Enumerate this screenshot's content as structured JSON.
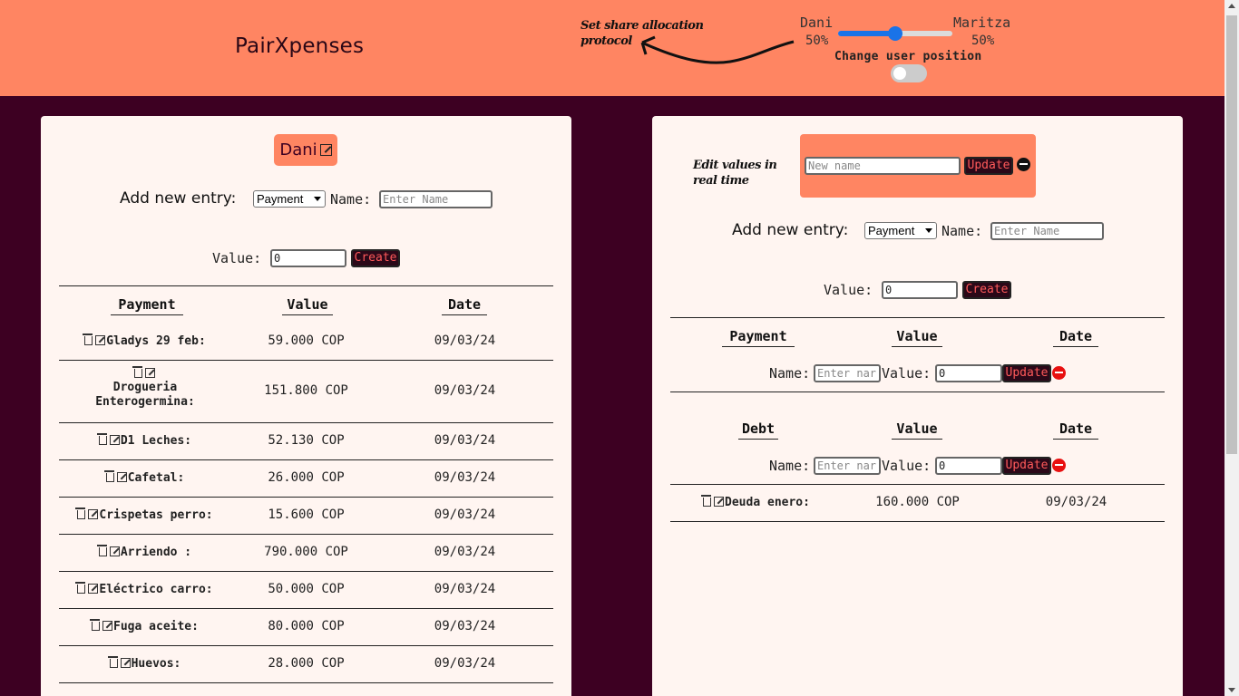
{
  "header": {
    "app_title": "PairXpenses",
    "annotation": "Set share allocation protocol",
    "slider": {
      "user_left": "Dani",
      "user_right": "Maritza",
      "pct_left": "50%",
      "pct_right": "50%",
      "value": 0.5,
      "accent": "#1a73e8"
    },
    "position_label": "Change user position",
    "toggle_on": false
  },
  "colors": {
    "header": "#ff8562",
    "background": "#3d0022",
    "card": "#fff5f1",
    "button_text": "#ff5a5a"
  },
  "left": {
    "user_name": "Dani",
    "add_entry_label": "Add new entry:",
    "entry_type": "Payment",
    "name_label": "Name:",
    "name_placeholder": "Enter Name",
    "value_label": "Value:",
    "value_input": "0",
    "create_label": "Create",
    "columns": [
      "Payment",
      "Value",
      "Date"
    ],
    "rows": [
      {
        "name": "Gladys 29 feb:",
        "value": "59.000 COP",
        "date": "09/03/24"
      },
      {
        "name": "Drogueria Enterogermina:",
        "value": "151.800 COP",
        "date": "09/03/24"
      },
      {
        "name": "D1 Leches:",
        "value": "52.130 COP",
        "date": "09/03/24"
      },
      {
        "name": "Cafetal:",
        "value": "26.000 COP",
        "date": "09/03/24"
      },
      {
        "name": "Crispetas perro:",
        "value": "15.600 COP",
        "date": "09/03/24"
      },
      {
        "name": "Arriendo :",
        "value": "790.000 COP",
        "date": "09/03/24"
      },
      {
        "name": "Eléctrico carro:",
        "value": "50.000 COP",
        "date": "09/03/24"
      },
      {
        "name": "Fuga aceite:",
        "value": "80.000 COP",
        "date": "09/03/24"
      },
      {
        "name": "Huevos:",
        "value": "28.000 COP",
        "date": "09/03/24"
      }
    ]
  },
  "right": {
    "annotation": "Edit values in real time",
    "rename_placeholder": "New name",
    "update_label": "Update",
    "add_entry_label": "Add new entry:",
    "entry_type": "Payment",
    "name_label": "Name:",
    "name_placeholder": "Enter Name",
    "value_label": "Value:",
    "value_input": "0",
    "create_label": "Create",
    "payment_columns": [
      "Payment",
      "Value",
      "Date"
    ],
    "edit_row": {
      "name_label": "Name:",
      "name_placeholder": "Enter nar",
      "value_label": "Value:",
      "value_input": "0",
      "update_label": "Update"
    },
    "debt_columns": [
      "Debt",
      "Value",
      "Date"
    ],
    "debt_edit_row": {
      "name_label": "Name:",
      "name_placeholder": "Enter nar",
      "value_label": "Value:",
      "value_input": "0",
      "update_label": "Update"
    },
    "debt_rows": [
      {
        "name": "Deuda enero:",
        "value": "160.000 COP",
        "date": "09/03/24"
      }
    ]
  }
}
